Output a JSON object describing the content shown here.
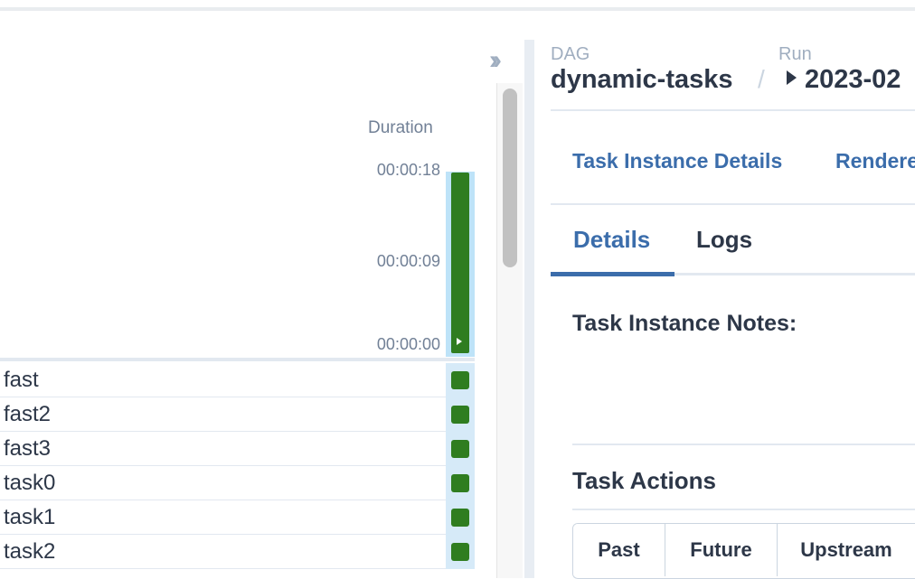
{
  "grid": {
    "duration_header": "Duration",
    "ticks": [
      "00:00:18",
      "00:00:09",
      "00:00:00"
    ],
    "run_duration_fraction": 1.0,
    "tasks": [
      "fast",
      "fast2",
      "fast3",
      "task0",
      "task1",
      "task2"
    ],
    "status_color": "#2f7d20"
  },
  "header": {
    "dag_label": "DAG",
    "dag_name": "dynamic-tasks",
    "separator": "/",
    "run_label": "Run",
    "run_name": "2023-02"
  },
  "task_links": {
    "details": "Task Instance Details",
    "rendered": "Rendered"
  },
  "tabs": {
    "details": "Details",
    "logs": "Logs"
  },
  "notes": {
    "title": "Task Instance Notes:"
  },
  "actions": {
    "title": "Task Actions",
    "past": "Past",
    "future": "Future",
    "upstream": "Upstream"
  },
  "colors": {
    "accent": "#3b6dab",
    "success": "#2f7d20",
    "highlight": "#bee3f8"
  },
  "icons": {
    "collapse": "chevron-double-right-icon",
    "run": "play-icon"
  }
}
